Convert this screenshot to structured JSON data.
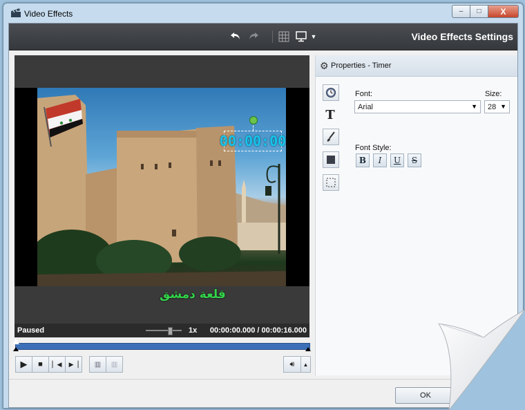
{
  "window": {
    "title": "Video Effects",
    "controls": {
      "minimize": "–",
      "maximize": "□",
      "close": "X"
    }
  },
  "toolbar": {
    "icons": [
      "undo-icon",
      "redo-icon",
      "grid-icon",
      "monitor-icon",
      "dropdown-arrow-icon"
    ],
    "title": "Video Effects Settings"
  },
  "preview": {
    "timer_overlay": "00:00:00",
    "arabic_caption": "قلعة دمشق"
  },
  "status": {
    "state": "Paused",
    "speed": "1x",
    "current_time": "00:00:00.000",
    "separator": "/",
    "total_time": "00:00:16.000",
    "playback_progress": 0
  },
  "playback_controls": {
    "icons": [
      "play-icon",
      "stop-icon",
      "previous-frame-icon",
      "next-frame-icon",
      "split-icon",
      "merge-icon"
    ],
    "volume_icon": "speaker-icon"
  },
  "properties": {
    "header": "Properties - Timer",
    "tools": [
      "clock-icon",
      "text-icon",
      "brush-icon",
      "fill-icon",
      "selection-icon"
    ],
    "font_label": "Font:",
    "font_value": "Arial",
    "size_label": "Size:",
    "size_value": "28",
    "font_style_label": "Font Style:",
    "styles": {
      "bold": "B",
      "italic": "I",
      "underline": "U",
      "strike": "S"
    }
  },
  "footer": {
    "ok_label": "OK"
  },
  "colors": {
    "timer_text": "#17c3ec",
    "caption_text": "#33d44a",
    "timeline_fill": "#3d6fb8",
    "toolbar_bg": "#3d4045"
  }
}
